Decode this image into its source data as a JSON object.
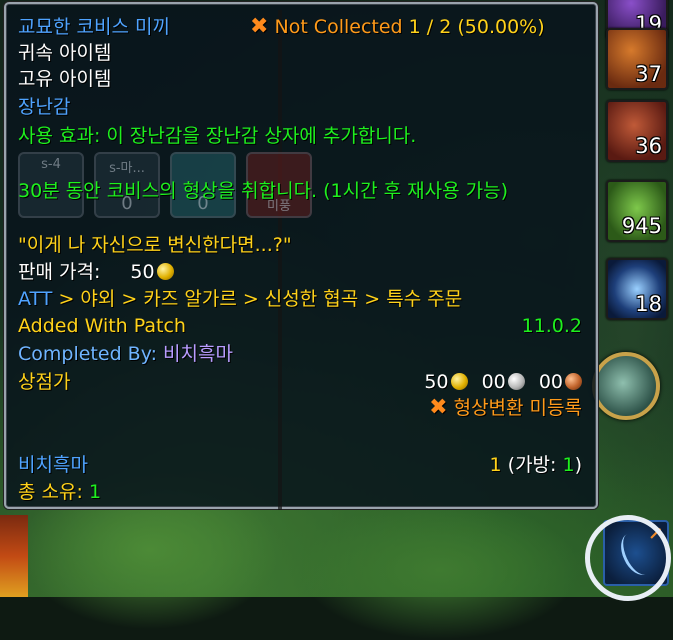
{
  "action_bar": {
    "slots": [
      {
        "icon": "purple-item-icon",
        "count": "19"
      },
      {
        "icon": "orange-item-icon",
        "count": "37"
      },
      {
        "icon": "red-fungus-icon",
        "count": "36"
      },
      {
        "icon": "green-seed-pod-icon",
        "count": "945"
      },
      {
        "icon": "blue-crystal-icon",
        "count": "18"
      }
    ],
    "highlighted_slot_icon": "hand-mirror-toy-icon"
  },
  "tooltip": {
    "item_name": "교묘한 코비스 미끼",
    "collection_status": {
      "icon": "x-icon",
      "label": "Not Collected",
      "count": "1 / 2 (50.00%)"
    },
    "binding": "귀속 아이템",
    "uniqueness": "고유 아이템",
    "item_type": "장난감",
    "use_effect": "사용 효과: 이 장난감을 장난감 상자에 추가합니다.",
    "effect_description": "30분 동안 코비스의 형상을 취합니다. (1시간 후 재사용 가능)",
    "flavor_text": "\"이게 나 자신으로 변신한다면...?\"",
    "sell_price_label": "판매 가격:",
    "sell_price_value": "50",
    "source_path": {
      "prefix": "ATT",
      "rest": " > 야외 > 카즈 알가르 > 신성한 협곡 > 특수 주문"
    },
    "patch_label": "Added With Patch",
    "patch_value": "11.0.2",
    "completed_by_label": "Completed By:",
    "completed_by_name": "비치흑마",
    "vendor_label": "상점가",
    "vendor_price": {
      "gold": "50",
      "silver": "00",
      "copper": "00"
    },
    "transmog_status": "형상변환 미등록",
    "character_name": "비치흑마",
    "character_count": "1",
    "bag_label_open": " (가방: ",
    "bag_count": "1",
    "bag_label_close": ")",
    "total_label": "총 소유:",
    "total_value": "1",
    "ghost_slots": [
      {
        "text": "s-4",
        "number": ""
      },
      {
        "text": "s-마...",
        "number": "0"
      },
      {
        "text": "",
        "number": "0"
      },
      {
        "text": "",
        "number": "미풍"
      }
    ]
  },
  "colors": {
    "item_name": "#4fa3ff",
    "green_text": "#1ef01e",
    "gold_text": "#ffd21a",
    "status_orange": "#ff9a1a"
  }
}
